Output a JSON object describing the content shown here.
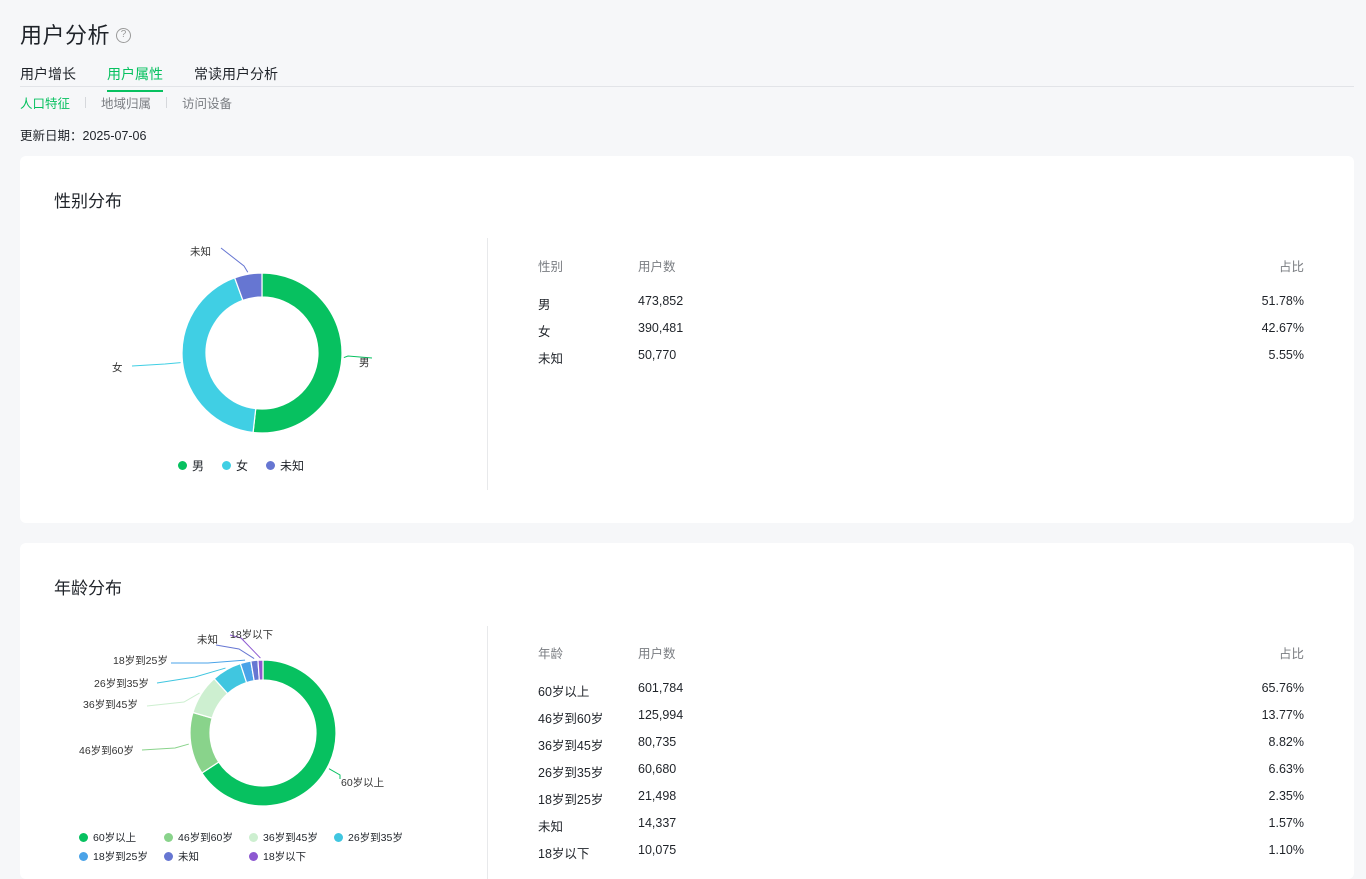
{
  "page": {
    "title": "用户分析",
    "help_icon": "question-circle-icon",
    "tabs": [
      {
        "label": "用户增长"
      },
      {
        "label": "用户属性"
      },
      {
        "label": "常读用户分析"
      }
    ],
    "subtabs": [
      {
        "label": "人口特征"
      },
      {
        "label": "地域归属"
      },
      {
        "label": "访问设备"
      }
    ],
    "update_label": "更新日期：",
    "update_date": "2025-07-06"
  },
  "gender": {
    "title": "性别分布",
    "headers": {
      "col1": "性别",
      "col2": "用户数",
      "col3": "占比"
    },
    "rows": [
      {
        "label": "男",
        "count": "473,852",
        "pct": "51.78%"
      },
      {
        "label": "女",
        "count": "390,481",
        "pct": "42.67%"
      },
      {
        "label": "未知",
        "count": "50,770",
        "pct": "5.55%"
      }
    ],
    "legend": [
      "男",
      "女",
      "未知"
    ]
  },
  "age": {
    "title": "年龄分布",
    "headers": {
      "col1": "年龄",
      "col2": "用户数",
      "col3": "占比"
    },
    "rows": [
      {
        "label": "60岁以上",
        "count": "601,784",
        "pct": "65.76%"
      },
      {
        "label": "46岁到60岁",
        "count": "125,994",
        "pct": "13.77%"
      },
      {
        "label": "36岁到45岁",
        "count": "80,735",
        "pct": "8.82%"
      },
      {
        "label": "26岁到35岁",
        "count": "60,680",
        "pct": "6.63%"
      },
      {
        "label": "18岁到25岁",
        "count": "21,498",
        "pct": "2.35%"
      },
      {
        "label": "未知",
        "count": "14,337",
        "pct": "1.57%"
      },
      {
        "label": "18岁以下",
        "count": "10,075",
        "pct": "1.10%"
      }
    ],
    "legend": [
      "60岁以上",
      "46岁到60岁",
      "36岁到45岁",
      "26岁到35岁",
      "18岁到25岁",
      "未知",
      "18岁以下"
    ]
  },
  "colors": {
    "accent": "#07c160",
    "gender": [
      "#07c160",
      "#40cfe4",
      "#6676d2"
    ],
    "age": [
      "#07c160",
      "#89d38b",
      "#cdefd0",
      "#40c6e0",
      "#4aa3e8",
      "#6676d2",
      "#8d59d1"
    ]
  },
  "chart_data": [
    {
      "type": "pie",
      "title": "性别分布",
      "categories": [
        "男",
        "女",
        "未知"
      ],
      "values": [
        473852,
        390481,
        50770
      ],
      "percent": [
        51.78,
        42.67,
        5.55
      ],
      "legend": "bottom"
    },
    {
      "type": "pie",
      "title": "年龄分布",
      "categories": [
        "60岁以上",
        "46岁到60岁",
        "36岁到45岁",
        "26岁到35岁",
        "18岁到25岁",
        "未知",
        "18岁以下"
      ],
      "values": [
        601784,
        125994,
        80735,
        60680,
        21498,
        14337,
        10075
      ],
      "percent": [
        65.76,
        13.77,
        8.82,
        6.63,
        2.35,
        1.57,
        1.1
      ],
      "legend": "bottom"
    }
  ]
}
